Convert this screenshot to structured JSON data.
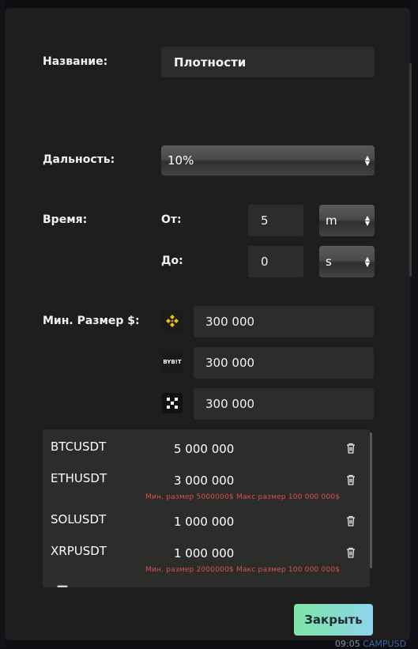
{
  "background": {
    "bottom_time": "09:05",
    "bottom_ticker": "CAMPUSD"
  },
  "form": {
    "name_label": "Название:",
    "name_value": "Плотности",
    "range_label": "Дальность:",
    "range_value": "10%",
    "time_label": "Время:",
    "from_label": "От:",
    "from_value": "5",
    "from_unit": "m",
    "to_label": "До:",
    "to_value": "0",
    "to_unit": "s",
    "min_size_label": "Мин. Размер $:",
    "exchanges": [
      {
        "icon": "binance-icon",
        "value": "300 000"
      },
      {
        "icon": "bybit-icon",
        "icon_text": "BYB!T",
        "value": "300 000"
      },
      {
        "icon": "okx-icon",
        "value": "300 000"
      }
    ]
  },
  "symbols": [
    {
      "pair": "BTCUSDT",
      "amount": "5 000 000",
      "warning": ""
    },
    {
      "pair": "ETHUSDT",
      "amount": "3 000 000",
      "warning": "Мин. размер 5000000$ Макс размер 100 000 000$"
    },
    {
      "pair": "SOLUSDT",
      "amount": "1 000 000",
      "warning": ""
    },
    {
      "pair": "XRPUSDT",
      "amount": "1 000 000",
      "warning": "Мин. размер 2000000$ Макс размер 100 000 000$"
    }
  ],
  "close_label": "Закрыть",
  "colors": {
    "accent_start": "#7fe3a6",
    "accent_end": "#8ed5ee",
    "warning": "#d9534f",
    "binance": "#f0b90b"
  }
}
